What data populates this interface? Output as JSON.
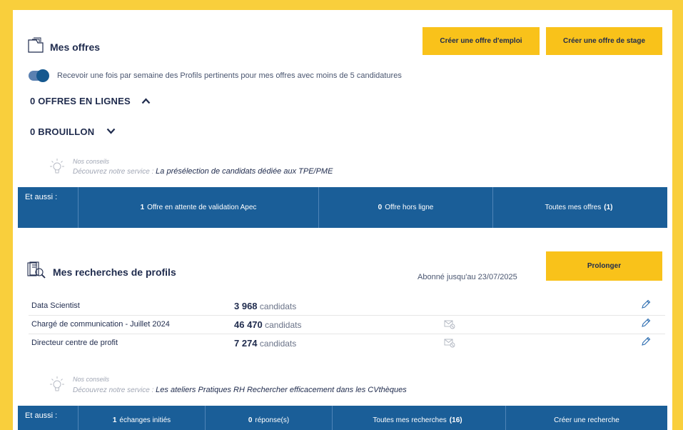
{
  "offers": {
    "title": "Mes offres",
    "create_job_label": "Créer une offre d'emploi",
    "create_internship_label": "Créer une offre de stage",
    "toggle_label": "Recevoir une fois par semaine des Profils pertinents pour mes offres avec moins de 5 candidatures",
    "toggle_on": true,
    "online_heading": "0 OFFRES EN LIGNES",
    "draft_heading": "0 BROUILLON",
    "tip_title": "Nos conseils",
    "tip_prefix": "Découvrez notre service :",
    "tip_link": "La présélection de candidats dédiée aux TPE/PME",
    "bar": {
      "label": "Et aussi :",
      "pending_count": "1",
      "pending_label": "Offre en attente de validation Apec",
      "offline_count": "0",
      "offline_label": "Offre hors ligne",
      "all_label": "Toutes mes offres",
      "all_count": "(1)"
    }
  },
  "searches": {
    "title": "Mes recherches de profils",
    "subscription": "Abonné jusqu'au 23/07/2025",
    "extend_label": "Prolonger",
    "rows": [
      {
        "name": "Data Scientist",
        "count": "3 968",
        "unit": "candidats",
        "mail_icon": false
      },
      {
        "name": "Chargé de communication - Juillet 2024",
        "count": "46 470",
        "unit": "candidats",
        "mail_icon": true
      },
      {
        "name": "Directeur centre de profit",
        "count": "7 274",
        "unit": "candidats",
        "mail_icon": true
      }
    ],
    "tip_title": "Nos conseils",
    "tip_prefix": "Découvrez notre service :",
    "tip_link": "Les ateliers Pratiques RH Rechercher efficacement dans les CVthèques",
    "bar": {
      "label": "Et aussi :",
      "exchanges_count": "1",
      "exchanges_label": "échanges initiés",
      "responses_count": "0",
      "responses_label": "réponse(s)",
      "all_label": "Toutes mes recherches",
      "all_count": "(16)",
      "create_label": "Créer une recherche"
    }
  },
  "colors": {
    "background": "#f9cf3c",
    "button": "#f9c21a",
    "bar": "#1a5e98",
    "text": "#1f2b4d"
  }
}
